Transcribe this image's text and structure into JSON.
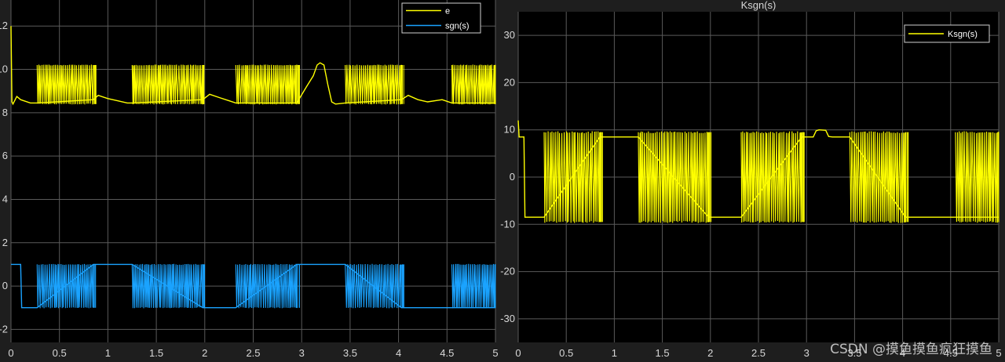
{
  "colors": {
    "figure_bg": "#1e1e1e",
    "axes_bg": "#000000",
    "grid": "#5a5a5a",
    "tick_text": "#d8d8d8",
    "yellow": "#ffff00",
    "blue": "#1aa3ff"
  },
  "watermark": "CSDN @摸鱼摸鱼疯狂摸鱼",
  "chart_data": [
    {
      "type": "line",
      "title": "",
      "xlabel": "",
      "ylabel": "",
      "xlim": [
        0,
        5
      ],
      "ylim": [
        -2.6,
        13.2
      ],
      "xticks": [
        0,
        0.5,
        1,
        1.5,
        2,
        2.5,
        3,
        3.5,
        4,
        4.5,
        5
      ],
      "xtick_labels": [
        "0",
        "0.5",
        "1",
        "1.5",
        "2",
        "2.5",
        "3",
        "3.5",
        "4",
        "4.5",
        "5"
      ],
      "yticks": [
        -2,
        0,
        2,
        4,
        6,
        8,
        10,
        12
      ],
      "ytick_labels": [
        "-2",
        "0",
        "2",
        "4",
        "6",
        "8",
        "10",
        "12"
      ],
      "grid": true,
      "legend": "top-right",
      "switching_bands": [
        [
          0.27,
          0.85
        ],
        [
          1.25,
          1.98
        ],
        [
          2.32,
          2.95
        ],
        [
          3.45,
          4.03
        ],
        [
          4.55,
          5.0
        ]
      ],
      "series": [
        {
          "name": "e",
          "color": "#ffff00",
          "upper": 10.2,
          "lower": 8.4,
          "x": [
            0,
            0.01,
            0.02,
            0.06,
            0.1,
            0.2,
            0.27,
            0.85,
            0.9,
            1.0,
            1.1,
            1.2,
            1.25,
            1.98,
            2.05,
            2.15,
            2.25,
            2.32,
            2.95,
            3.05,
            3.12,
            3.16,
            3.19,
            3.23,
            3.27,
            3.31,
            3.35,
            3.45,
            4.03,
            4.1,
            4.2,
            4.3,
            4.45,
            4.55,
            5.0
          ],
          "y": [
            12.0,
            8.5,
            8.4,
            8.75,
            8.6,
            8.45,
            8.45,
            8.6,
            8.8,
            8.65,
            8.55,
            8.45,
            8.45,
            8.6,
            8.85,
            8.7,
            8.55,
            8.45,
            8.45,
            9.2,
            9.7,
            10.2,
            10.3,
            10.2,
            9.3,
            8.5,
            8.4,
            8.45,
            8.6,
            8.8,
            8.6,
            8.5,
            8.6,
            8.45,
            8.45
          ]
        },
        {
          "name": "sgn(s)",
          "color": "#1aa3ff",
          "upper": 1,
          "lower": -1,
          "x": [
            0,
            0.1,
            0.11,
            0.27,
            0.85,
            1.25,
            1.98,
            2.32,
            2.95,
            3.45,
            4.03,
            4.55,
            5.0
          ],
          "y": [
            1,
            1,
            -1,
            -1,
            1,
            1,
            -1,
            -1,
            1,
            1,
            -1,
            -1,
            -1
          ]
        }
      ]
    },
    {
      "type": "line",
      "title": "Ksgn(s)",
      "xlabel": "",
      "ylabel": "",
      "xlim": [
        0,
        5
      ],
      "ylim": [
        -35,
        35
      ],
      "xticks": [
        0,
        0.5,
        1,
        1.5,
        2,
        2.5,
        3,
        3.5,
        4,
        4.5,
        5
      ],
      "xtick_labels": [
        "0",
        "0.5",
        "1",
        "1.5",
        "2",
        "2.5",
        "3",
        "3.5",
        "4",
        "4.5",
        "5"
      ],
      "yticks": [
        -30,
        -20,
        -10,
        0,
        10,
        20,
        30
      ],
      "ytick_labels": [
        "-30",
        "-20",
        "-10",
        "0",
        "10",
        "20",
        "30"
      ],
      "grid": true,
      "legend": "top-right",
      "switching_bands": [
        [
          0.27,
          0.85
        ],
        [
          1.25,
          1.98
        ],
        [
          2.32,
          2.95
        ],
        [
          3.45,
          4.03
        ],
        [
          4.55,
          5.0
        ]
      ],
      "series": [
        {
          "name": "Ksgn(s)",
          "color": "#ffff00",
          "upper": 9.5,
          "lower": -9.5,
          "x": [
            0,
            0.01,
            0.02,
            0.06,
            0.07,
            0.27,
            0.85,
            1.25,
            1.98,
            2.32,
            2.95,
            3.07,
            3.1,
            3.13,
            3.2,
            3.23,
            3.27,
            3.45,
            4.03,
            4.55,
            5.0
          ],
          "y": [
            12,
            8.5,
            8.5,
            8.5,
            -8.5,
            -8.5,
            8.5,
            8.5,
            -8.5,
            -8.5,
            8.5,
            8.5,
            9.8,
            10.0,
            9.9,
            8.6,
            8.5,
            8.5,
            -8.5,
            -8.5,
            -8.5
          ]
        }
      ]
    }
  ]
}
